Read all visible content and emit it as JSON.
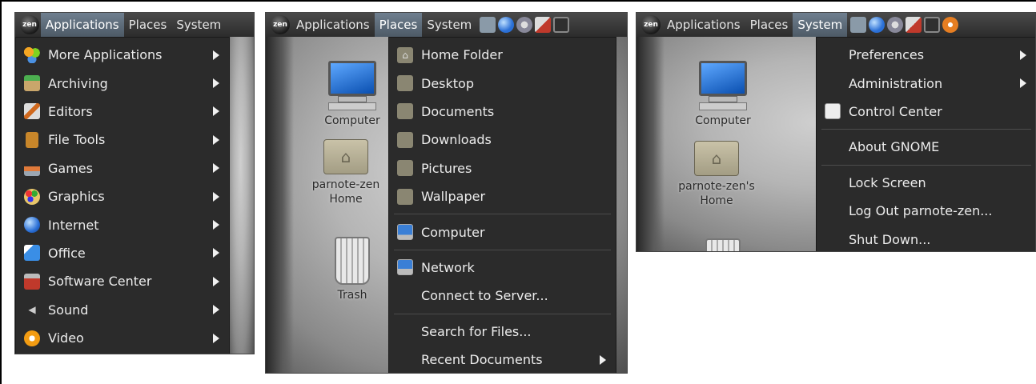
{
  "panel": {
    "logo": "zen",
    "applications": "Applications",
    "places": "Places",
    "system": "System"
  },
  "applications_menu": [
    {
      "label": "More Applications",
      "icon": "more-applications-icon"
    },
    {
      "label": "Archiving",
      "icon": "archiving-icon"
    },
    {
      "label": "Editors",
      "icon": "editors-icon"
    },
    {
      "label": "File Tools",
      "icon": "file-tools-icon"
    },
    {
      "label": "Games",
      "icon": "games-icon"
    },
    {
      "label": "Graphics",
      "icon": "graphics-icon"
    },
    {
      "label": "Internet",
      "icon": "internet-icon"
    },
    {
      "label": "Office",
      "icon": "office-icon"
    },
    {
      "label": "Software Center",
      "icon": "software-center-icon"
    },
    {
      "label": "Sound",
      "icon": "sound-icon"
    },
    {
      "label": "Video",
      "icon": "video-icon"
    }
  ],
  "places_menu": {
    "home_folder": "Home Folder",
    "desktop": "Desktop",
    "documents": "Documents",
    "downloads": "Downloads",
    "pictures": "Pictures",
    "wallpaper": "Wallpaper",
    "computer": "Computer",
    "network": "Network",
    "connect_to_server": "Connect to Server...",
    "search_for_files": "Search for Files...",
    "recent_documents": "Recent Documents"
  },
  "system_menu": {
    "preferences": "Preferences",
    "administration": "Administration",
    "control_center": "Control Center",
    "about_gnome": "About GNOME",
    "lock_screen": "Lock Screen",
    "log_out": "Log Out parnote-zen...",
    "shut_down": "Shut Down..."
  },
  "desktop_icons": {
    "computer": "Computer",
    "home_short_1": "parnote-zen",
    "home_short_2": "Home",
    "home_long_1": "parnote-zen's",
    "home_long_2": "Home",
    "trash": "Trash"
  },
  "colors": {
    "menu_bg": "#2b2b2b",
    "panel_active": "#5d6b78",
    "menu_text": "#ececec"
  }
}
